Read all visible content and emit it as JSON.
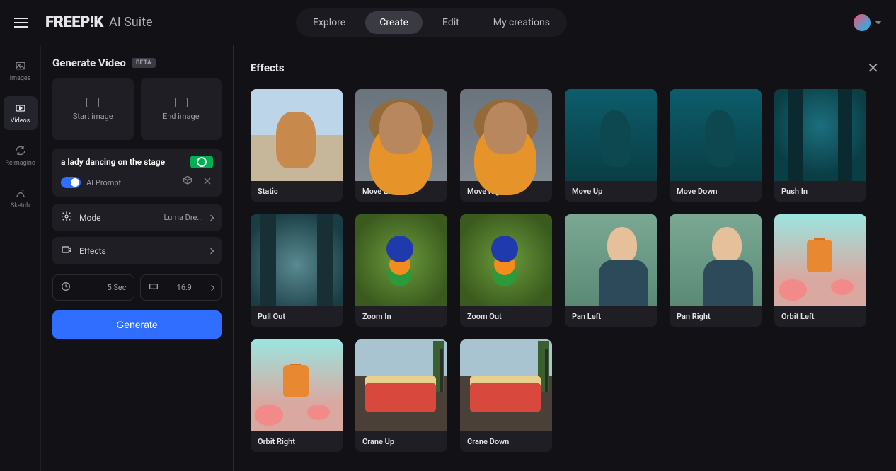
{
  "header": {
    "logo": "FREEP!K",
    "suite": "AI Suite",
    "nav": {
      "explore": "Explore",
      "create": "Create",
      "edit": "Edit",
      "my_creations": "My creations"
    }
  },
  "rail": {
    "images": "Images",
    "videos": "Videos",
    "reimagine": "Reimagine",
    "sketch": "Sketch"
  },
  "sidebar": {
    "title": "Generate Video",
    "beta": "BETA",
    "start_image": "Start image",
    "end_image": "End image",
    "prompt": "a lady dancing on the stage",
    "ai_prompt_label": "AI Prompt",
    "mode_label": "Mode",
    "mode_value": "Luma Dre...",
    "effects_label": "Effects",
    "duration": "5 Sec",
    "ratio": "16:9",
    "generate": "Generate"
  },
  "main": {
    "title": "Effects",
    "effects": [
      {
        "label": "Static",
        "cls": "t-dog"
      },
      {
        "label": "Move Left",
        "cls": "t-woman"
      },
      {
        "label": "Move Right",
        "cls": "t-woman"
      },
      {
        "label": "Move Up",
        "cls": "t-mermaid"
      },
      {
        "label": "Move Down",
        "cls": "t-mermaid"
      },
      {
        "label": "Push In",
        "cls": "t-city"
      },
      {
        "label": "Pull Out",
        "cls": "t-cityfog"
      },
      {
        "label": "Zoom In",
        "cls": "t-parrot"
      },
      {
        "label": "Zoom Out",
        "cls": "t-parrot"
      },
      {
        "label": "Pan Left",
        "cls": "t-armor"
      },
      {
        "label": "Pan Right",
        "cls": "t-armor"
      },
      {
        "label": "Orbit Left",
        "cls": "t-perfume"
      },
      {
        "label": "Orbit Right",
        "cls": "t-perfume"
      },
      {
        "label": "Crane Up",
        "cls": "t-diner"
      },
      {
        "label": "Crane Down",
        "cls": "t-diner"
      }
    ]
  }
}
